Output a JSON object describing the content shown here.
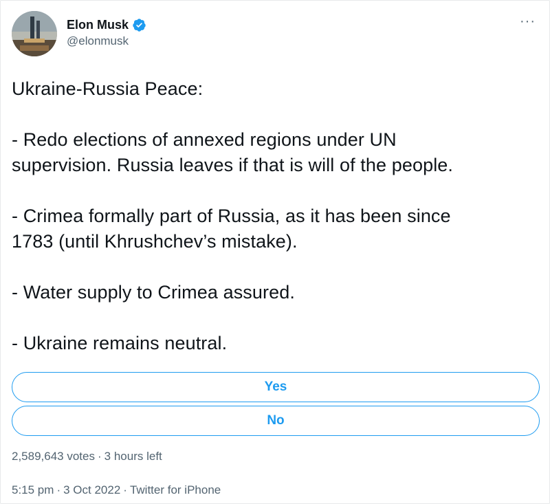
{
  "author": {
    "name": "Elon Musk",
    "handle": "@elonmusk",
    "verified": true
  },
  "more_label": "···",
  "tweet": {
    "line1": "Ukraine-Russia Peace:",
    "p1_line1": "- Redo elections of annexed regions under UN",
    "p1_line2": "supervision. Russia leaves if that is will of the people.",
    "p2_line1": "- Crimea formally part of Russia, as it has been since",
    "p2_line2": "1783 (until Khrushchev’s mistake).",
    "p3": "- Water supply to Crimea assured.",
    "p4": "- Ukraine remains neutral."
  },
  "poll": {
    "options": [
      "Yes",
      "No"
    ],
    "votes": "2,589,643 votes",
    "time_left": "3 hours left"
  },
  "meta": {
    "time": "5:15 pm",
    "date": "3 Oct 2022",
    "source": "Twitter for iPhone",
    "separator": "·"
  },
  "colors": {
    "accent": "#1d9bf0",
    "text": "#0f1419",
    "secondary": "#536471"
  }
}
